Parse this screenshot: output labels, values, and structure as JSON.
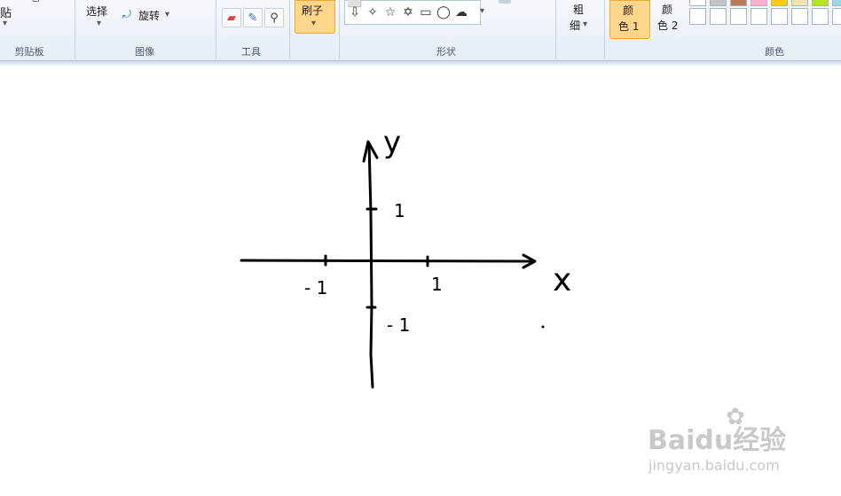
{
  "ribbon": {
    "clipboard": {
      "paste_label": "贴",
      "group_label": "剪贴板"
    },
    "image": {
      "select_label": "选择",
      "rotate_label": "旋转",
      "group_label": "图像"
    },
    "tools": {
      "group_label": "工具"
    },
    "brush": {
      "label": "刷子"
    },
    "shapes": {
      "group_label": "形状"
    },
    "size": {
      "label_line1": "粗",
      "label_line2": "细"
    },
    "colors": {
      "color1_line1": "颜",
      "color1_line2": "色 1",
      "color2_line1": "颜",
      "color2_line2": "色 2",
      "group_label": "颜色",
      "palette_row1": [
        "#ffffff",
        "#c3c3c3",
        "#b97a57",
        "#ffaec9",
        "#ffc90e",
        "#efe4b0",
        "#b5e61d",
        "#99d9ea"
      ],
      "palette_row2": [
        "#ffffff",
        "#ffffff",
        "#ffffff",
        "#ffffff",
        "#ffffff",
        "#ffffff",
        "#ffffff",
        "#ffffff"
      ],
      "accent": "#ffd68a"
    }
  },
  "drawing": {
    "y_label": "y",
    "x_label": "x",
    "y_tick_pos": "1",
    "y_tick_neg": "- 1",
    "x_tick_pos": "1",
    "x_tick_neg": "- 1"
  },
  "watermark": {
    "brand": "Baidu经验",
    "url": "jingyan.baidu.com"
  }
}
